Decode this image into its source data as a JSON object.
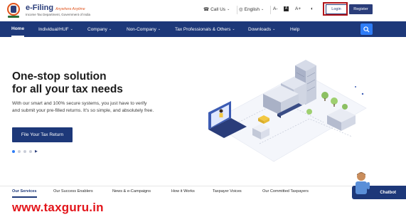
{
  "header": {
    "brand": "e-Filing",
    "brand_sub": "Anywhere Anytime",
    "tagline": "Income Tax Department, Government of India",
    "call_us": "Call Us",
    "language": "English",
    "font_decrease": "A-",
    "font_reset": "A",
    "font_increase": "A+",
    "login": "Login",
    "register": "Register"
  },
  "nav": {
    "items": [
      {
        "label": "Home"
      },
      {
        "label": "Individual/HUF"
      },
      {
        "label": "Company"
      },
      {
        "label": "Non-Company"
      },
      {
        "label": "Tax Professionals & Others"
      },
      {
        "label": "Downloads"
      },
      {
        "label": "Help"
      }
    ]
  },
  "hero": {
    "title_line1": "One-stop solution",
    "title_line2": "for all your tax needs",
    "text": "With our smart and 100% secure systems, you just have to verify and submit your pre-filled returns. It's so simple, and absolutely free.",
    "cta": "File Your Tax Return",
    "slide_count": 5,
    "active_slide": 1
  },
  "tabs": {
    "items": [
      {
        "label": "Our Services"
      },
      {
        "label": "Our Success Enablers"
      },
      {
        "label": "News & e-Campaigns"
      },
      {
        "label": "How it Works"
      },
      {
        "label": "Taxpayer Voices"
      },
      {
        "label": "Our Committed Taxpayers"
      }
    ],
    "chatbot": "Chatbot"
  },
  "watermark": "www.taxguru.in",
  "colors": {
    "primary": "#1d3879",
    "accent": "#2e7cf6",
    "highlight": "#b0141a",
    "watermark": "#e3151b"
  }
}
